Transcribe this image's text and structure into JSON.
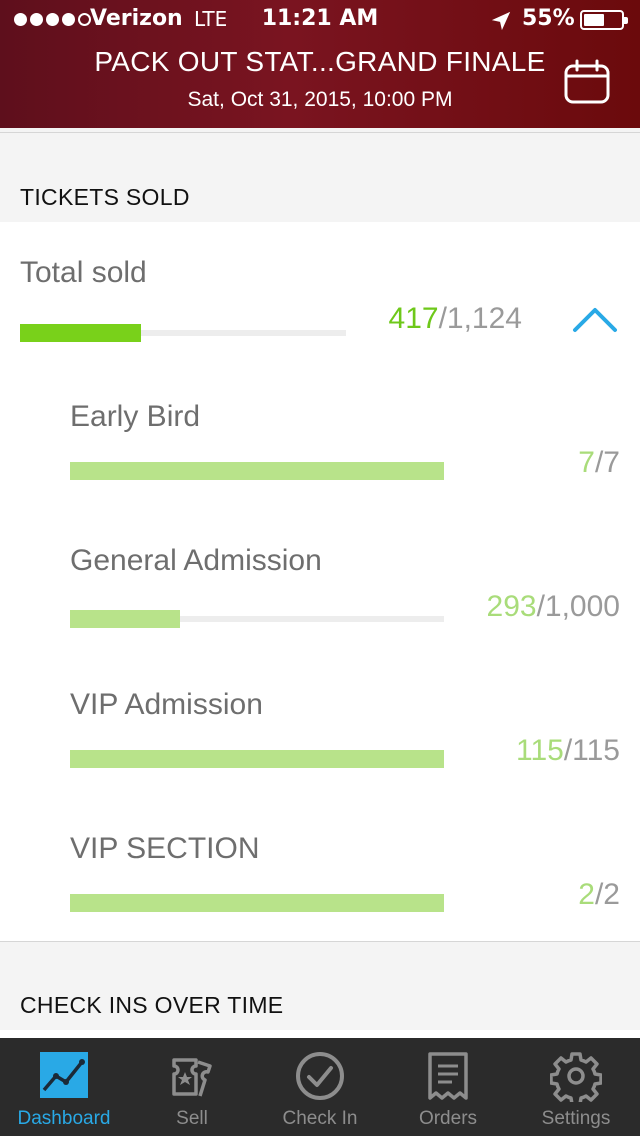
{
  "status_bar": {
    "carrier": "Verizon",
    "network": "LTE",
    "time": "11:21 AM",
    "battery": "55%",
    "battery_level": 0.55
  },
  "header": {
    "title": "PACK OUT STAT...GRAND FINALE",
    "date": "Sat, Oct 31, 2015, 10:00 PM",
    "calendar_icon": "calendar-icon"
  },
  "tickets_sold": {
    "section_title": "TICKETS SOLD",
    "total": {
      "label": "Total sold",
      "sold": "417",
      "capacity": "/1,124",
      "fraction": 0.371
    },
    "types": [
      {
        "label": "Early Bird",
        "sold": "7",
        "capacity": "/7",
        "fraction": 1.0
      },
      {
        "label": "General Admission",
        "sold": "293",
        "capacity": "/1,000",
        "fraction": 0.293
      },
      {
        "label": "VIP Admission",
        "sold": "115",
        "capacity": "/115",
        "fraction": 1.0
      },
      {
        "label": "VIP SECTION",
        "sold": "2",
        "capacity": "/2",
        "fraction": 1.0
      }
    ]
  },
  "check_ins": {
    "section_title": "CHECK INS OVER TIME"
  },
  "tab_bar": {
    "tabs": [
      {
        "label": "Dashboard",
        "icon": "dashboard-chart-icon",
        "active": true
      },
      {
        "label": "Sell",
        "icon": "tickets-icon",
        "active": false
      },
      {
        "label": "Check In",
        "icon": "checkmark-circle-icon",
        "active": false
      },
      {
        "label": "Orders",
        "icon": "receipt-icon",
        "active": false
      },
      {
        "label": "Settings",
        "icon": "gear-icon",
        "active": false
      }
    ]
  },
  "colors": {
    "accent_blue": "#29a9e6",
    "total_green": "#79d11a",
    "sub_green": "#b8e38a",
    "header_red": "#6b0a0c"
  }
}
